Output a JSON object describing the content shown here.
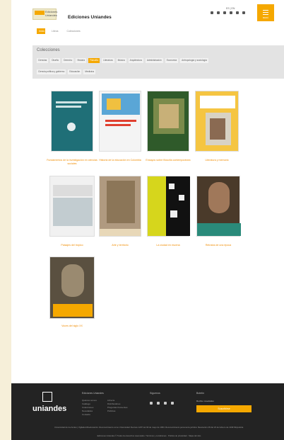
{
  "header": {
    "site_title": "Ediciones Uniandes",
    "logo_text": "Ediciones Uniandes",
    "language": "ES | EN",
    "menu_label": "MENÚ"
  },
  "tabs": [
    "Inicio",
    "Libros",
    "Colecciones"
  ],
  "filter": {
    "title": "Colecciones",
    "row1": [
      "Ciencias",
      "Diseño",
      "Derecho",
      "Historia",
      "Filosofía",
      "Literatura",
      "Música",
      "Arquitectura",
      "Administración",
      "Economía",
      "Antropología y sociología"
    ],
    "row2": [
      "Ciencia política y gobierno",
      "Educación",
      "Medicina"
    ],
    "active_index": 4
  },
  "books": [
    {
      "caption": "Fundamentos de la investigación en ciencias sociales"
    },
    {
      "caption": "Historia de la educación en Colombia"
    },
    {
      "caption": "Ensayos sobre filosofía contemporánea"
    },
    {
      "caption": "Literatura y memoria"
    },
    {
      "caption": "Paisajes del trópico"
    },
    {
      "caption": "Arte y territorio"
    },
    {
      "caption": "La ciudad en escena"
    },
    {
      "caption": "Retratos de una época"
    },
    {
      "caption": "Voces del siglo XX"
    }
  ],
  "footer": {
    "brand": "uniandes",
    "col1_title": "Ediciones Uniandes",
    "col1_links": [
      "Quiénes somos",
      "Catálogo",
      "Colecciones",
      "Novedades",
      "Contacto"
    ],
    "col2_links": [
      "Librería",
      "Distribuidores",
      "Preguntas frecuentes",
      "Políticas"
    ],
    "col3_title": "Síguenos",
    "col4_title": "Boletín",
    "newsletter_label": "Recibe novedades",
    "subscribe": "Suscribirse",
    "copyright": "Universidad de los Andes | Vigilada Mineducación. Reconocimiento como Universidad: Decreto 1297 del 30 de mayo de 1964. Reconocimiento personería jurídica: Resolución 28 del 23 de febrero de 1949 Minjusticia.",
    "legal": "Ediciones Uniandes © Todos los derechos reservados. Términos y condiciones · Política de privacidad · Mapa del sitio"
  }
}
